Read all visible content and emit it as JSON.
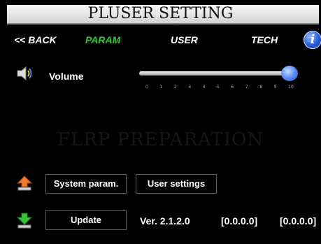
{
  "header": {
    "title": "PLUSER SETTING"
  },
  "nav": {
    "back": "<< BACK",
    "param": "PARAM",
    "user": "USER",
    "tech": "TECH",
    "info_icon": "i",
    "active_color": "#2ecc2e"
  },
  "volume": {
    "label": "Volume",
    "value": 10,
    "min": 0,
    "max": 10,
    "ticks": [
      "0",
      "1",
      "2",
      "3",
      "4",
      "5",
      "6",
      "7",
      "8",
      "9",
      "10"
    ]
  },
  "background_text": "FLRP PREPARATION",
  "buttons": {
    "system_param": "System param.",
    "user_settings": "User settings",
    "update": "Update"
  },
  "status": {
    "version": "Ver. 2.1.2.0",
    "value1": "[0.0.0.0]",
    "value2": "[0.0.0.0]"
  }
}
